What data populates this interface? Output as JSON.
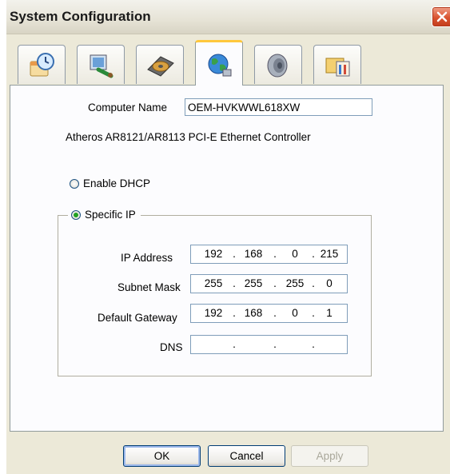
{
  "window": {
    "title": "System Configuration"
  },
  "tabs": [
    {
      "icon": "clock-calendar-icon",
      "active": false
    },
    {
      "icon": "display-settings-icon",
      "active": false
    },
    {
      "icon": "hard-disk-icon",
      "active": false
    },
    {
      "icon": "network-globe-icon",
      "active": true
    },
    {
      "icon": "speaker-icon",
      "active": false
    },
    {
      "icon": "folder-tools-icon",
      "active": false
    }
  ],
  "network": {
    "computer_name_label": "Computer Name",
    "computer_name_value": "OEM-HVKWWL618XW",
    "adapter_name": "Atheros AR8121/AR8113 PCI-E Ethernet Controller",
    "enable_dhcp_label": "Enable DHCP",
    "specific_ip_label": "Specific IP",
    "dhcp_selected": false,
    "specific_ip_selected": true,
    "ip_address_label": "IP Address",
    "ip_address": [
      "192",
      "168",
      "0",
      "215"
    ],
    "subnet_mask_label": "Subnet Mask",
    "subnet_mask": [
      "255",
      "255",
      "255",
      "0"
    ],
    "gateway_label": "Default Gateway",
    "gateway": [
      "192",
      "168",
      "0",
      "1"
    ],
    "dns_label": "DNS",
    "dns": [
      "",
      "",
      "",
      ""
    ]
  },
  "buttons": {
    "ok": "OK",
    "cancel": "Cancel",
    "apply": "Apply"
  },
  "colors": {
    "active_tab_accent": "#ffc83c",
    "radio_checked": "#21a121",
    "close_button": "#d9532f"
  }
}
